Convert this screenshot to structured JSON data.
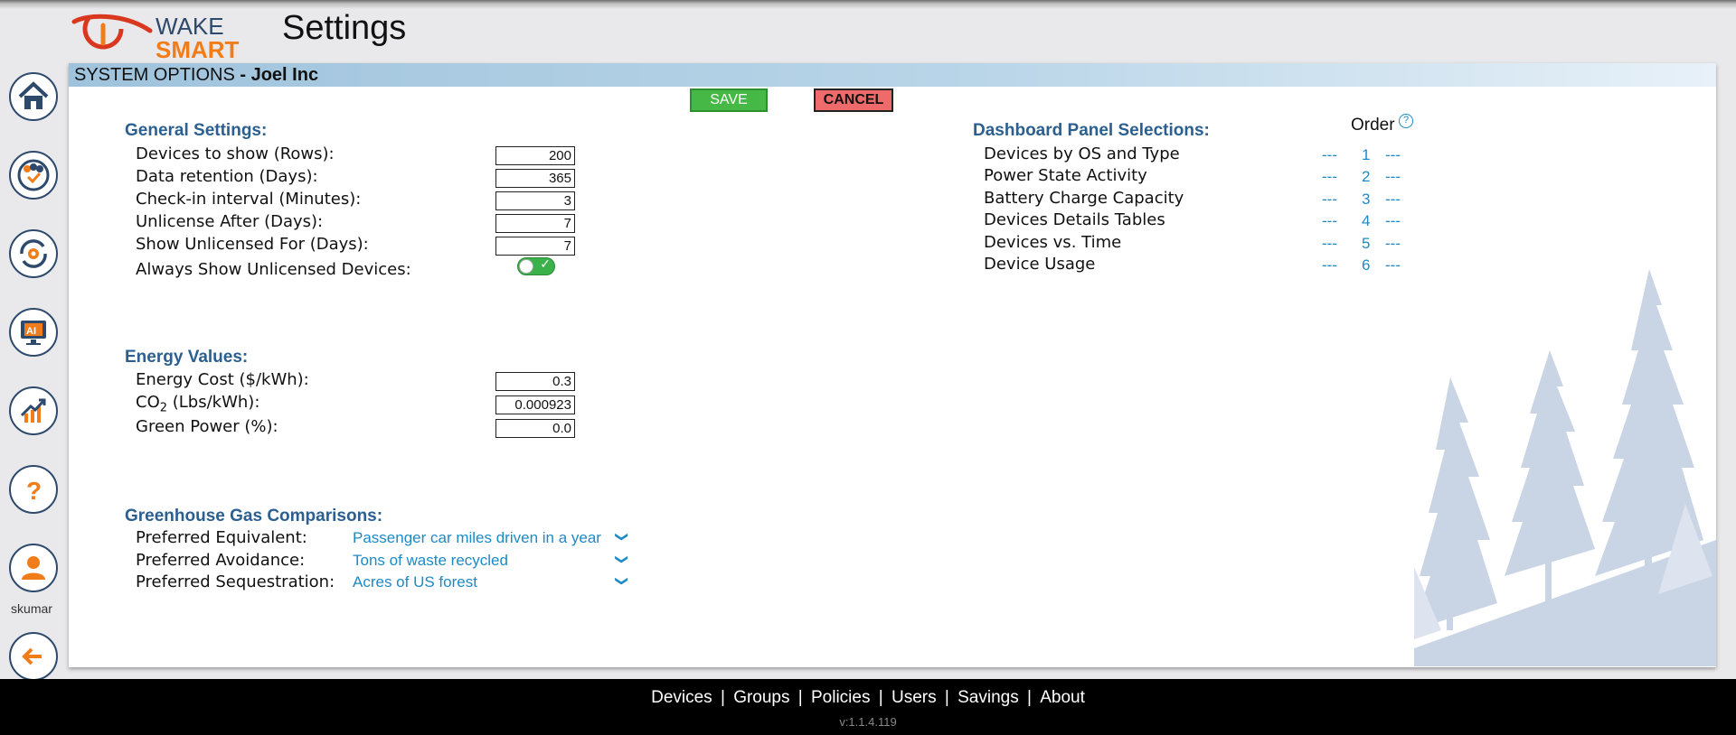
{
  "app": {
    "logo_text_1": "WAKE",
    "logo_text_2": "SMART",
    "page_title": "Settings"
  },
  "header": {
    "section": "SYSTEM OPTIONS",
    "company": "- Joel Inc"
  },
  "buttons": {
    "save": "SAVE",
    "cancel": "CANCEL"
  },
  "sidebar": {
    "items": [
      {
        "name": "home-icon"
      },
      {
        "name": "groups-icon"
      },
      {
        "name": "policies-icon"
      },
      {
        "name": "ai-icon"
      },
      {
        "name": "savings-icon"
      },
      {
        "name": "help-icon"
      },
      {
        "name": "user-icon"
      },
      {
        "name": "logout-icon"
      }
    ],
    "username": "skumar"
  },
  "general": {
    "title": "General Settings:",
    "rows": [
      {
        "label": "Devices to show (Rows):",
        "value": "200"
      },
      {
        "label": "Data retention (Days):",
        "value": "365"
      },
      {
        "label": "Check-in interval (Minutes):",
        "value": "3"
      },
      {
        "label": "Unlicense After (Days):",
        "value": "7"
      },
      {
        "label": "Show Unlicensed For (Days):",
        "value": "7"
      }
    ],
    "always_show_label": "Always Show Unlicensed Devices:",
    "always_show_on": true
  },
  "energy": {
    "title": "Energy Values:",
    "cost_label": "Energy Cost ($/kWh):",
    "cost_value": "0.3",
    "co2_label_main": "CO",
    "co2_label_sub": "2",
    "co2_label_rest": " (Lbs/kWh):",
    "co2_value": "0.000923",
    "green_label": "Green Power (%):",
    "green_value": "0.0"
  },
  "ghg": {
    "title": "Greenhouse Gas Comparisons:",
    "rows": [
      {
        "label": "Preferred Equivalent:",
        "value": "Passenger car miles driven in a year"
      },
      {
        "label": "Preferred Avoidance:",
        "value": "Tons of waste recycled"
      },
      {
        "label": "Preferred Sequestration:",
        "value": "Acres of US forest"
      }
    ]
  },
  "dashboard": {
    "title": "Dashboard Panel Selections:",
    "order_header": "Order",
    "help_glyph": "?",
    "panels": [
      {
        "label": "Devices by OS and Type",
        "order": "1",
        "left": "---",
        "right": "---"
      },
      {
        "label": "Power State Activity",
        "order": "2",
        "left": "---",
        "right": "---"
      },
      {
        "label": "Battery Charge Capacity",
        "order": "3",
        "left": "---",
        "right": "---"
      },
      {
        "label": "Devices Details Tables",
        "order": "4",
        "left": "---",
        "right": "---"
      },
      {
        "label": "Devices vs. Time",
        "order": "5",
        "left": "---",
        "right": "---"
      },
      {
        "label": "Device Usage",
        "order": "6",
        "left": "---",
        "right": "---"
      }
    ]
  },
  "footer": {
    "links": [
      "Devices",
      "Groups",
      "Policies",
      "Users",
      "Savings",
      "About"
    ],
    "separator": "|",
    "version": "v:1.1.4.119"
  },
  "colors": {
    "section_title": "#2a5f8f",
    "link_blue": "#1d8ac6",
    "save_green": "#45b845",
    "cancel_red": "#ef6b6b",
    "header_blue": "#9fc3dc",
    "logo_orange": "#f07d1a",
    "logo_red": "#d9371e"
  }
}
